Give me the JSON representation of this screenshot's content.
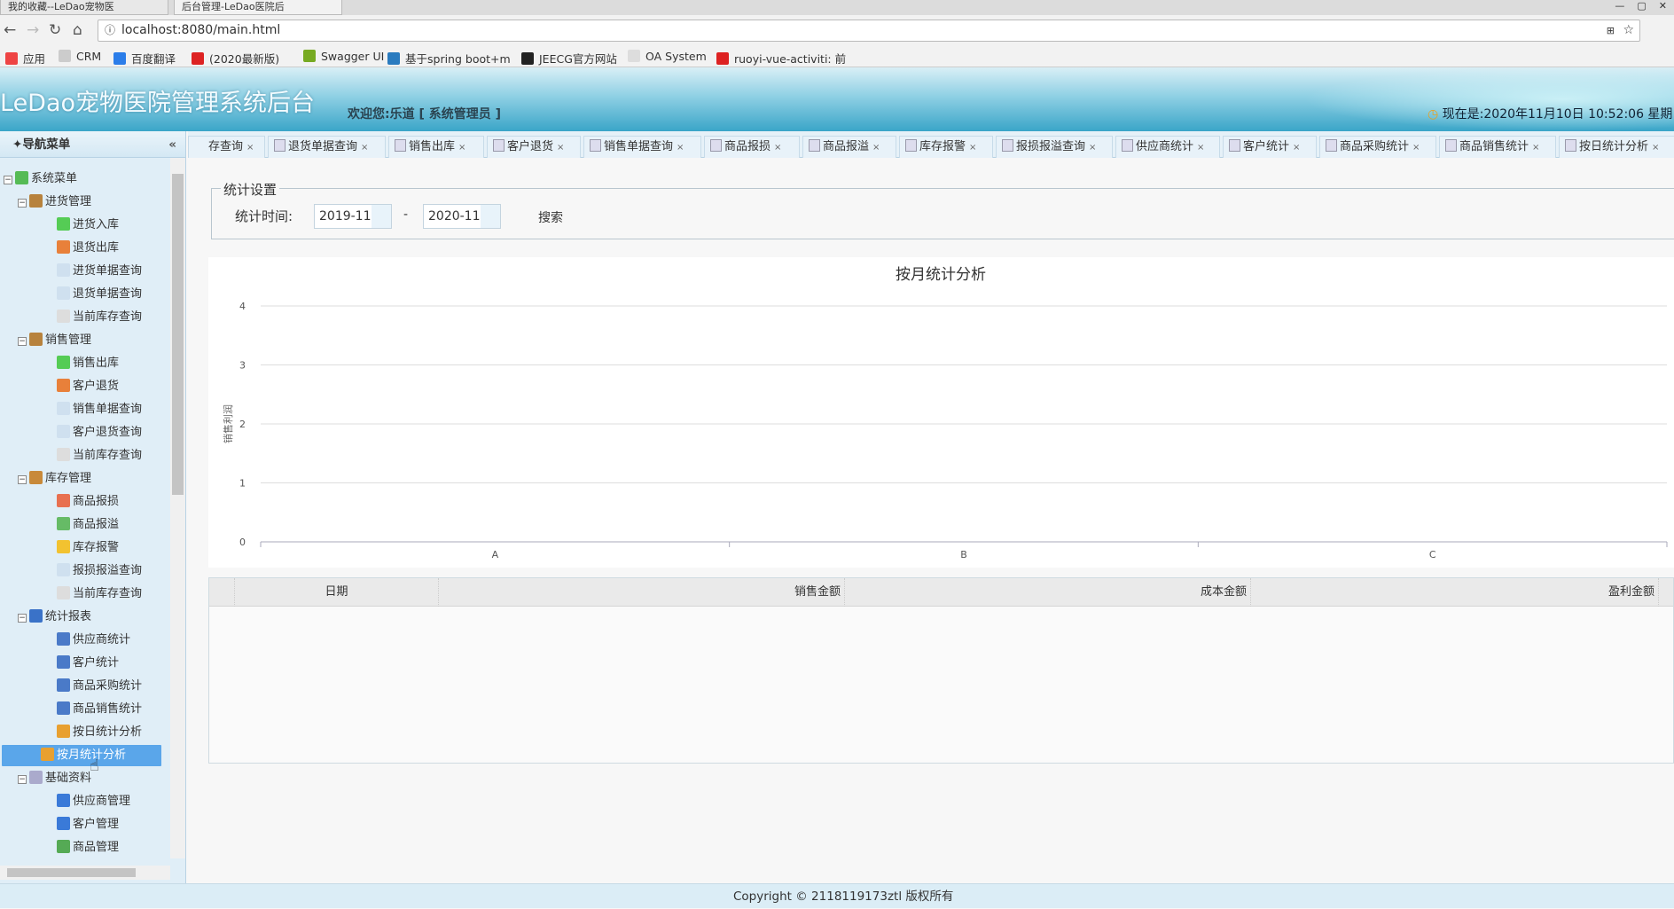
{
  "browser": {
    "tabs": [
      "我的收藏--LeDao宠物医",
      "后台管理-LeDao医院后"
    ],
    "url": "localhost:8080/main.html",
    "bookmarks": [
      {
        "label": "应用",
        "color": "#e44"
      },
      {
        "label": "CRM",
        "color": "#ccc"
      },
      {
        "label": "百度翻译",
        "color": "#2b7de9"
      },
      {
        "label": "(2020最新版)",
        "color": "#d22"
      },
      {
        "label": "Swagger UI",
        "color": "#7a2"
      },
      {
        "label": "基于spring boot+m",
        "color": "#2a7bbf"
      },
      {
        "label": "JEECG官方网站",
        "color": "#222"
      },
      {
        "label": "OA System",
        "color": "#ddd"
      },
      {
        "label": "ruoyi-vue-activiti: 前",
        "color": "#d22"
      }
    ]
  },
  "header": {
    "title": "LeDao宠物医院管理系统后台",
    "welcome": "欢迎您:乐道 [ 系统管理员 ]",
    "clock": "现在是:2020年11月10日 10:52:06 星期"
  },
  "sidebar": {
    "title": "导航菜单",
    "collapse": "«",
    "items": [
      {
        "label": "系统菜单",
        "level": 0,
        "toggle": true,
        "color": "#5b5"
      },
      {
        "label": "进货管理",
        "level": 1,
        "toggle": true,
        "color": "#b7823d"
      },
      {
        "label": "进货入库",
        "level": 2,
        "color": "#5c5"
      },
      {
        "label": "退货出库",
        "level": 2,
        "color": "#e8803a"
      },
      {
        "label": "进货单据查询",
        "level": 2,
        "color": "#cfe0ef"
      },
      {
        "label": "退货单据查询",
        "level": 2,
        "color": "#cfe0ef"
      },
      {
        "label": "当前库存查询",
        "level": 2,
        "color": "#ddd"
      },
      {
        "label": "销售管理",
        "level": 1,
        "toggle": true,
        "color": "#b7823d"
      },
      {
        "label": "销售出库",
        "level": 2,
        "color": "#5c5"
      },
      {
        "label": "客户退货",
        "level": 2,
        "color": "#e8803a"
      },
      {
        "label": "销售单据查询",
        "level": 2,
        "color": "#cfe0ef"
      },
      {
        "label": "客户退货查询",
        "level": 2,
        "color": "#cfe0ef"
      },
      {
        "label": "当前库存查询",
        "level": 2,
        "color": "#ddd"
      },
      {
        "label": "库存管理",
        "level": 1,
        "toggle": true,
        "color": "#c8893a"
      },
      {
        "label": "商品报损",
        "level": 2,
        "color": "#e87050"
      },
      {
        "label": "商品报溢",
        "level": 2,
        "color": "#6b6"
      },
      {
        "label": "库存报警",
        "level": 2,
        "color": "#f2c230"
      },
      {
        "label": "报损报溢查询",
        "level": 2,
        "color": "#cfe0ef"
      },
      {
        "label": "当前库存查询",
        "level": 2,
        "color": "#ddd"
      },
      {
        "label": "统计报表",
        "level": 1,
        "toggle": true,
        "color": "#3a72c8"
      },
      {
        "label": "供应商统计",
        "level": 2,
        "color": "#4a7ac8"
      },
      {
        "label": "客户统计",
        "level": 2,
        "color": "#4a7ac8"
      },
      {
        "label": "商品采购统计",
        "level": 2,
        "color": "#4a7ac8"
      },
      {
        "label": "商品销售统计",
        "level": 2,
        "color": "#4a7ac8"
      },
      {
        "label": "按日统计分析",
        "level": 2,
        "color": "#e8a030"
      },
      {
        "label": "按月统计分析",
        "level": 2,
        "color": "#e8a030",
        "selected": true
      },
      {
        "label": "基础资料",
        "level": 1,
        "toggle": true,
        "color": "#aac"
      },
      {
        "label": "供应商管理",
        "level": 2,
        "color": "#3a7ad8"
      },
      {
        "label": "客户管理",
        "level": 2,
        "color": "#3a7ad8"
      },
      {
        "label": "商品管理",
        "level": 2,
        "color": "#5a5"
      }
    ]
  },
  "tabs": {
    "scroll_left": "«",
    "items": [
      "存查询",
      "退货单据查询",
      "销售出库",
      "客户退货",
      "销售单据查询",
      "商品报损",
      "商品报溢",
      "库存报警",
      "报损报溢查询",
      "供应商统计",
      "客户统计",
      "商品采购统计",
      "商品销售统计",
      "按日统计分析"
    ],
    "close": "×"
  },
  "filter": {
    "legend": "统计设置",
    "label": "统计时间:",
    "start": "2019-11",
    "end": "2020-11",
    "separator": "-",
    "search": "搜索"
  },
  "chart_data": {
    "type": "bar",
    "title": "按月统计分析",
    "ylabel": "销售利润",
    "xlabel": "",
    "categories": [
      "A",
      "B",
      "C"
    ],
    "values": [
      0,
      0,
      0
    ],
    "ylim": [
      0,
      4
    ],
    "yticks": [
      "0",
      "1",
      "2",
      "3",
      "4"
    ],
    "grid": true
  },
  "table": {
    "columns": [
      "日期",
      "销售金额",
      "成本金额",
      "盈利金额"
    ],
    "rows": []
  },
  "footer": {
    "copyright": "Copyright © 2118119173ztl 版权所有"
  }
}
